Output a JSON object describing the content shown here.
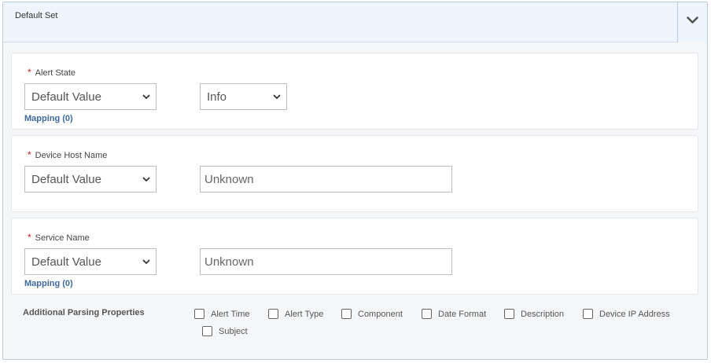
{
  "panel": {
    "title": "Default Set"
  },
  "fields": [
    {
      "label": "Alert State",
      "required_mark": "*",
      "source_value": "Default Value",
      "value": "Info",
      "value_type": "select",
      "mapping": "Mapping (0)"
    },
    {
      "label": "Device Host Name",
      "required_mark": "*",
      "source_value": "Default Value",
      "value": "Unknown",
      "value_type": "text"
    },
    {
      "label": "Service Name",
      "required_mark": "*",
      "source_value": "Default Value",
      "value": "Unknown",
      "value_type": "text",
      "mapping": "Mapping (0)"
    }
  ],
  "additional": {
    "label": "Additional Parsing Properties",
    "options": [
      {
        "label": "Alert Time",
        "checked": false
      },
      {
        "label": "Alert Type",
        "checked": false
      },
      {
        "label": "Component",
        "checked": false
      },
      {
        "label": "Date Format",
        "checked": false
      },
      {
        "label": "Description",
        "checked": false
      },
      {
        "label": "Device IP Address",
        "checked": false
      },
      {
        "label": "Subject",
        "checked": false
      }
    ]
  },
  "colors": {
    "accent": "#3d6a9e",
    "required": "#d11b1b",
    "header_bg": "#eef5fd",
    "border": "#b7cbe1"
  },
  "icons": {
    "collapse": "chevron-down-icon",
    "select_arrow": "chevron-down-icon"
  }
}
